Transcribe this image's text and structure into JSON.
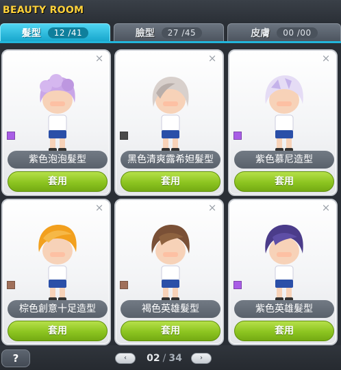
{
  "window": {
    "title": "BEAUTY ROOM"
  },
  "tabs": [
    {
      "label": "髮型",
      "count": "12 /41",
      "active": true
    },
    {
      "label": "臉型",
      "count": "27 /45",
      "active": false
    },
    {
      "label": "皮膚",
      "count": "00 /00",
      "active": false
    }
  ],
  "close_glyph": "×",
  "apply_label": "套用",
  "items": [
    {
      "name": "紫色泡泡髮型",
      "swatch_color": "#a95de6",
      "hair_color": "#c9a6e8",
      "hair_icon": "bubble-hair"
    },
    {
      "name": "黑色清爽露希妲髮型",
      "swatch_color": "#4a4a4a",
      "hair_color": "#d8d0cc",
      "hair_icon": "lucida-hair"
    },
    {
      "name": "紫色慕尼造型",
      "swatch_color": "#a95de6",
      "hair_color": "#e5dcf5",
      "hair_icon": "muni-hair"
    },
    {
      "name": "棕色創意十足造型",
      "swatch_color": "#a0705a",
      "hair_color": "#f2a01e",
      "hair_icon": "creative-hair"
    },
    {
      "name": "褐色英雄髮型",
      "swatch_color": "#a0705a",
      "hair_color": "#7a5036",
      "hair_icon": "hero-hair"
    },
    {
      "name": "紫色英雄髮型",
      "swatch_color": "#a95de6",
      "hair_color": "#4b3c8a",
      "hair_icon": "hero-hair"
    }
  ],
  "pager": {
    "prev": "‹",
    "next": "›",
    "current": "02",
    "separator": "/",
    "total": "34"
  },
  "help": {
    "label": "?"
  },
  "colors": {
    "accent": "#22b6dc",
    "apply_green": "#8cc420",
    "title_yellow": "#ffd23a"
  }
}
